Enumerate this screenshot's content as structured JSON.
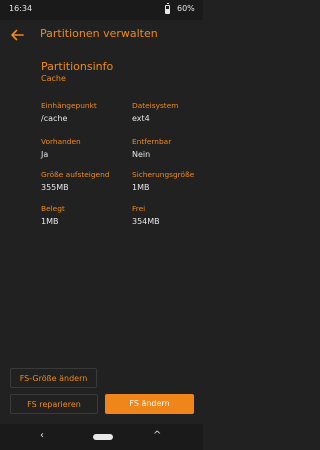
{
  "status": {
    "time": "16:34",
    "battery": "60%"
  },
  "appbar": {
    "title": "Partitionen verwalten"
  },
  "partition": {
    "heading": "Partitionsinfo",
    "name": "Cache",
    "fields": [
      {
        "label": "Einhängepunkt",
        "value": "/cache"
      },
      {
        "label": "Dateisystem",
        "value": "ext4"
      },
      {
        "label": "Vorhanden",
        "value": "Ja"
      },
      {
        "label": "Entfernbar",
        "value": "Nein"
      },
      {
        "label": "Größe aufsteigend",
        "value": "355MB"
      },
      {
        "label": "Sicherungsgröße",
        "value": "1MB"
      },
      {
        "label": "Belegt",
        "value": "1MB"
      },
      {
        "label": "Frei",
        "value": "354MB"
      }
    ]
  },
  "buttons": {
    "resize": "FS-Größe ändern",
    "repair": "FS reparieren",
    "change": "FS ändern"
  },
  "navbar": {
    "back": "‹",
    "up": "^"
  },
  "colors": {
    "accent": "#f08a1c",
    "background": "#212121"
  }
}
